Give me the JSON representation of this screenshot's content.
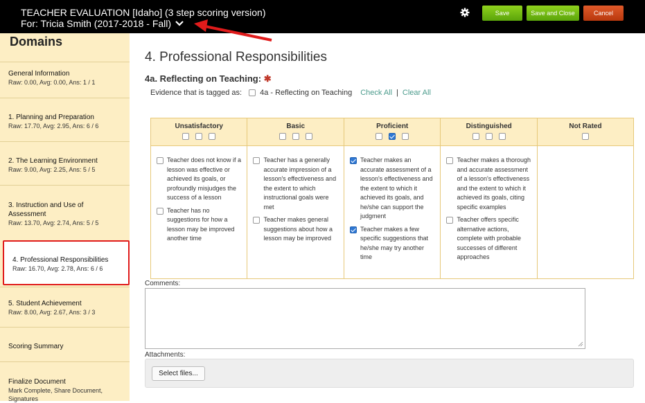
{
  "header": {
    "title": "TEACHER EVALUATION [Idaho] (3 step scoring version)",
    "subtitle": "For: Tricia Smith (2017-2018 - Fall)",
    "save_label": "Save",
    "save_close_label": "Save and Close",
    "cancel_label": "Cancel"
  },
  "sidebar": {
    "heading": "Domains",
    "items": [
      {
        "label": "General Information",
        "stat": "Raw: 0.00, Avg: 0.00, Ans: 1 / 1"
      },
      {
        "label": "1. Planning and Preparation",
        "stat": "Raw: 17.70, Avg: 2.95, Ans: 6 / 6"
      },
      {
        "label": "2. The Learning Environment",
        "stat": "Raw: 9.00, Avg: 2.25, Ans: 5 / 5"
      },
      {
        "label": "3. Instruction and Use of Assessment",
        "stat": "Raw: 13.70, Avg: 2.74, Ans: 5 / 5"
      },
      {
        "label": "4. Professional Responsibilities",
        "stat": "Raw: 16.70, Avg: 2.78, Ans: 6 / 6"
      },
      {
        "label": "5. Student Achievement",
        "stat": "Raw: 8.00, Avg: 2.67, Ans: 3 / 3"
      },
      {
        "label": "Scoring Summary",
        "stat": ""
      },
      {
        "label": "Finalize Document",
        "stat": "Mark Complete, Share Document, Signatures"
      }
    ]
  },
  "main": {
    "page_title": "4. Professional Responsibilities",
    "section_title": "4a. Reflecting on Teaching:",
    "required_mark": "✱",
    "evidence_prefix": "Evidence that is tagged as:",
    "evidence_tag": "4a - Reflecting on Teaching",
    "check_all": "Check All",
    "clear_all": "Clear All",
    "separator": "|",
    "comments_label": "Comments:",
    "attachments_label": "Attachments:",
    "select_files": "Select files..."
  },
  "rubric": {
    "columns": [
      {
        "name": "Unsatisfactory",
        "boxes": [
          false,
          false,
          false
        ],
        "options": [
          {
            "checked": false,
            "text": "Teacher does not know if a lesson was effective or achieved its goals, or profoundly misjudges the success of a lesson"
          },
          {
            "checked": false,
            "text": "Teacher has no suggestions for how a lesson may be improved another time"
          }
        ]
      },
      {
        "name": "Basic",
        "boxes": [
          false,
          false,
          false
        ],
        "options": [
          {
            "checked": false,
            "text": "Teacher has a generally accurate impression of a lesson's effectiveness and the extent to which instructional goals were met"
          },
          {
            "checked": false,
            "text": "Teacher makes general suggestions about how a lesson may be improved"
          }
        ]
      },
      {
        "name": "Proficient",
        "boxes": [
          false,
          true,
          false
        ],
        "options": [
          {
            "checked": true,
            "text": "Teacher makes an accurate assessment of a lesson's effectiveness and the extent to which it achieved its goals, and he/she can support the judgment"
          },
          {
            "checked": true,
            "text": "Teacher makes a few specific suggestions that he/she may try another time"
          }
        ]
      },
      {
        "name": "Distinguished",
        "boxes": [
          false,
          false,
          false
        ],
        "options": [
          {
            "checked": false,
            "text": "Teacher makes a thorough and accurate assessment of a lesson's effectiveness and the extent to which it achieved its goals, citing specific examples"
          },
          {
            "checked": false,
            "text": "Teacher offers specific alternative actions, complete with probable successes of different approaches"
          }
        ]
      },
      {
        "name": "Not Rated",
        "boxes": [
          false
        ],
        "options": []
      }
    ]
  },
  "colors": {
    "sidebar_bg": "#fdeec4",
    "save_green": "#6cb512",
    "cancel_red": "#c9441a",
    "highlight_red": "#e01b1b",
    "link_teal": "#4b9b8c"
  }
}
